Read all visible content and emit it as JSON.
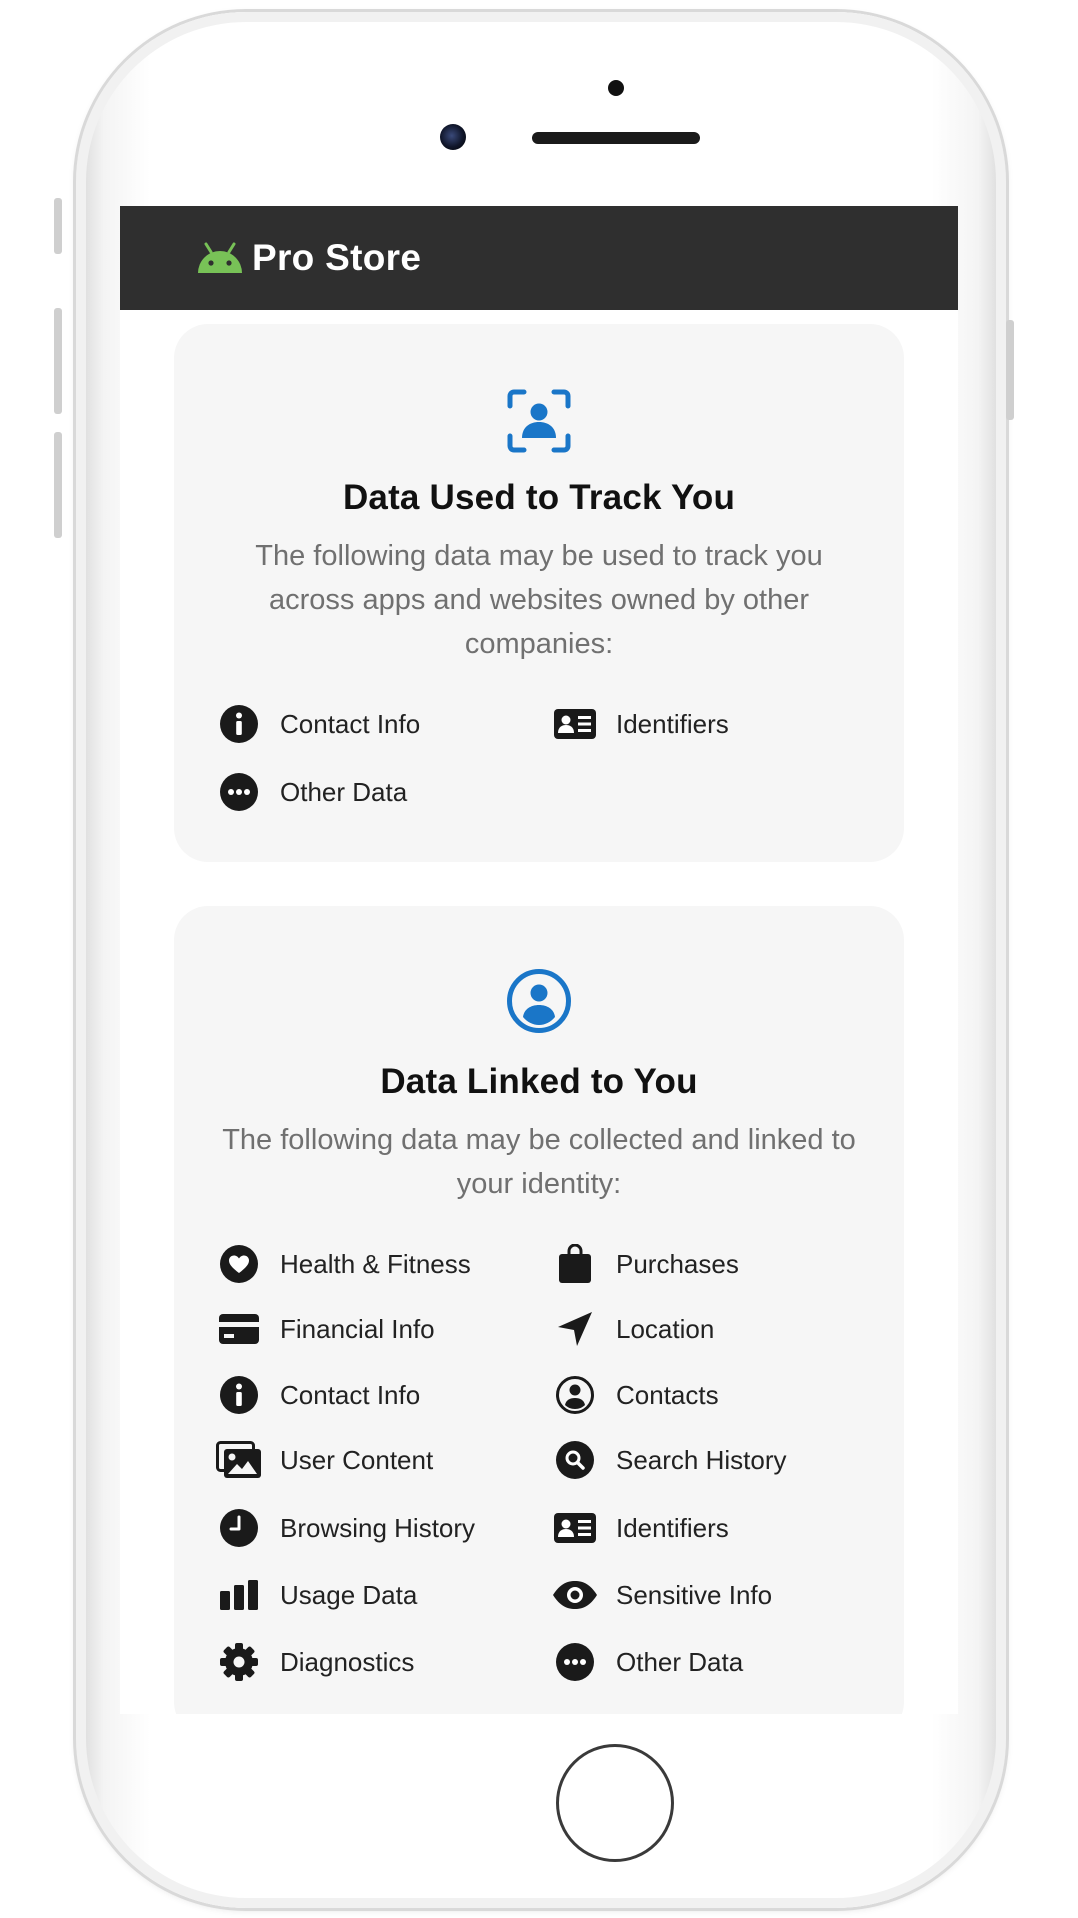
{
  "app": {
    "name": "Pro Store",
    "brand_color": "#2f2f2f",
    "logo_icon": "android-icon",
    "logo_color": "#78c257"
  },
  "tracking": {
    "icon": "person-tracking-icon",
    "accent": "#1a76c8",
    "title": "Data Used to Track You",
    "description": "The following data may be used to track you across apps and websites owned by other companies:",
    "items": [
      {
        "label": "Contact Info",
        "icon": "info-icon"
      },
      {
        "label": "Identifiers",
        "icon": "id-card-icon"
      },
      {
        "label": "Other Data",
        "icon": "more-icon"
      }
    ]
  },
  "linked": {
    "icon": "user-circle-icon",
    "accent": "#1a76c8",
    "title": "Data Linked to You",
    "description": "The following data may be collected and linked to your identity:",
    "items": [
      {
        "label": "Health & Fitness",
        "icon": "heart-icon"
      },
      {
        "label": "Purchases",
        "icon": "shopping-bag-icon"
      },
      {
        "label": "Financial Info",
        "icon": "credit-card-icon"
      },
      {
        "label": "Location",
        "icon": "location-arrow-icon"
      },
      {
        "label": "Contact Info",
        "icon": "info-icon"
      },
      {
        "label": "Contacts",
        "icon": "contacts-icon"
      },
      {
        "label": "User Content",
        "icon": "images-icon"
      },
      {
        "label": "Search History",
        "icon": "search-icon"
      },
      {
        "label": "Browsing History",
        "icon": "clock-icon"
      },
      {
        "label": "Identifiers",
        "icon": "id-card-icon"
      },
      {
        "label": "Usage Data",
        "icon": "bar-chart-icon"
      },
      {
        "label": "Sensitive Info",
        "icon": "eye-icon"
      },
      {
        "label": "Diagnostics",
        "icon": "gear-icon"
      },
      {
        "label": "Other Data",
        "icon": "more-icon"
      }
    ]
  }
}
